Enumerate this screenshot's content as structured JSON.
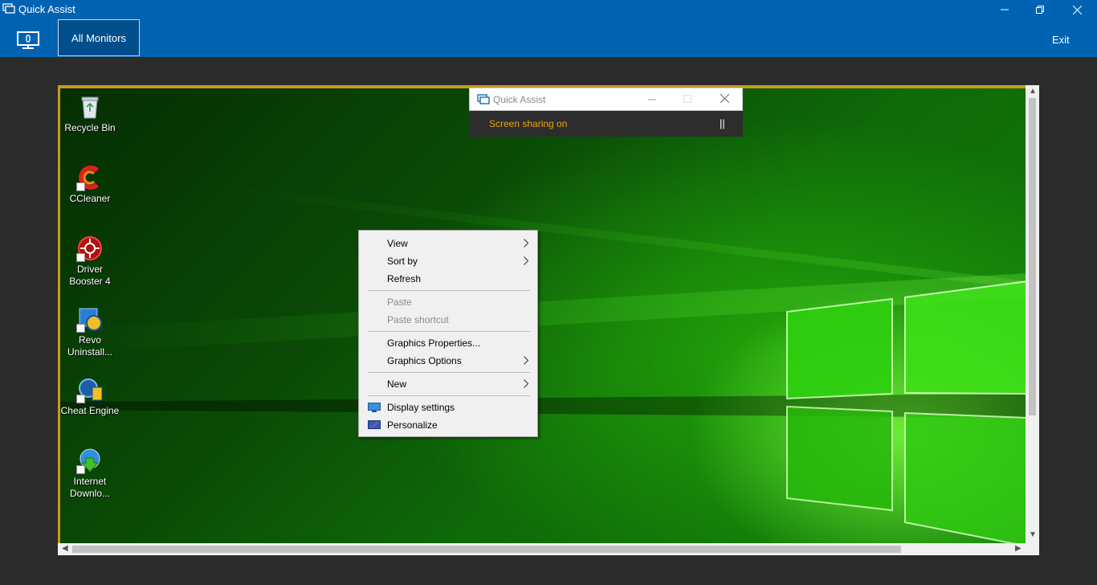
{
  "window": {
    "title": "Quick Assist",
    "controls": [
      "minimize",
      "restore",
      "close"
    ]
  },
  "toolbar": {
    "monitor_icon": "monitor-icon",
    "all_monitors_label": "All Monitors",
    "exit_label": "Exit"
  },
  "desktop": {
    "icons": [
      {
        "label": "Recycle Bin",
        "icon": "recycle-bin-icon"
      },
      {
        "label": "CCleaner",
        "icon": "ccleaner-icon"
      },
      {
        "label": "Driver Booster 4",
        "icon": "driver-booster-icon"
      },
      {
        "label": "Revo Uninstall...",
        "icon": "revo-uninstaller-icon"
      },
      {
        "label": "Cheat Engine",
        "icon": "cheat-engine-icon"
      },
      {
        "label": "Internet Downlo...",
        "icon": "internet-download-manager-icon"
      }
    ]
  },
  "qa_mini": {
    "title": "Quick Assist",
    "status": "Screen sharing on",
    "pause_symbol": "||"
  },
  "context_menu": {
    "items": [
      {
        "label": "View",
        "submenu": true,
        "disabled": false
      },
      {
        "label": "Sort by",
        "submenu": true,
        "disabled": false
      },
      {
        "label": "Refresh",
        "submenu": false,
        "disabled": false
      },
      {
        "label": "Paste",
        "submenu": false,
        "disabled": true
      },
      {
        "label": "Paste shortcut",
        "submenu": false,
        "disabled": true
      },
      {
        "label": "Graphics Properties...",
        "submenu": false,
        "disabled": false
      },
      {
        "label": "Graphics Options",
        "submenu": true,
        "disabled": false
      },
      {
        "label": "New",
        "submenu": true,
        "disabled": false
      },
      {
        "label": "Display settings",
        "submenu": false,
        "disabled": false,
        "icon": "display-settings-icon"
      },
      {
        "label": "Personalize",
        "submenu": false,
        "disabled": false,
        "icon": "personalize-icon"
      }
    ]
  },
  "colors": {
    "titlebar": "#0063b1",
    "accent_border": "#c49c18",
    "status_text": "#f0a30a"
  }
}
